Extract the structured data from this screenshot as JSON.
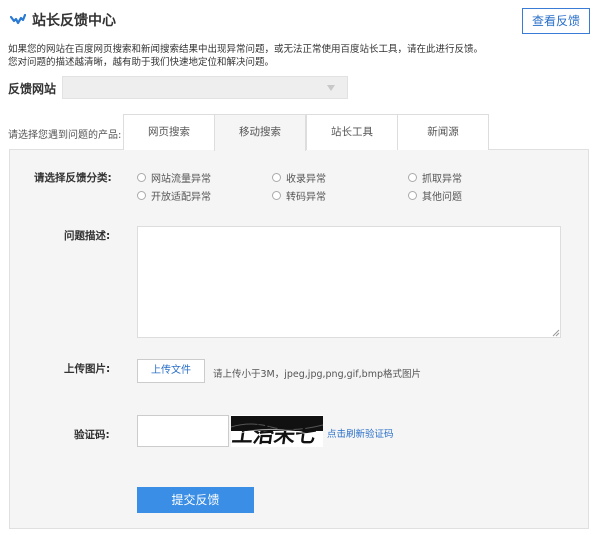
{
  "header": {
    "title": "站长反馈中心",
    "view_feedback_label": "查看反馈"
  },
  "intro": {
    "line1": "如果您的网站在百度网页搜索和新闻搜索结果中出现异常问题，或无法正常使用百度站长工具，请在此进行反馈。",
    "line2": "您对问题的描述越清晰，越有助于我们快速地定位和解决问题。"
  },
  "site": {
    "label": "反馈网站",
    "selected_value": ""
  },
  "products": {
    "label": "请选择您遇到问题的产品:",
    "tabs": [
      {
        "label": "网页搜索",
        "active": false
      },
      {
        "label": "移动搜索",
        "active": true
      },
      {
        "label": "站长工具",
        "active": false
      },
      {
        "label": "新闻源",
        "active": false
      }
    ]
  },
  "form": {
    "category_label": "请选择反馈分类:",
    "categories": [
      "网站流量异常",
      "收录异常",
      "抓取异常",
      "开放适配异常",
      "转码异常",
      "其他问题"
    ],
    "description_label": "问题描述:",
    "description_value": "",
    "upload_label": "上传图片:",
    "upload_button": "上传文件",
    "upload_hint": "请上传小于3M，jpeg,jpg,png,gif,bmp格式图片",
    "captcha_label": "验证码:",
    "captcha_value": "",
    "captcha_text": "工治未七",
    "captcha_refresh": "点击刷新验证码",
    "submit_label": "提交反馈"
  },
  "colors": {
    "accent": "#3a8ee6",
    "link": "#2a6fc9",
    "panel_bg": "#f5f5f5"
  }
}
